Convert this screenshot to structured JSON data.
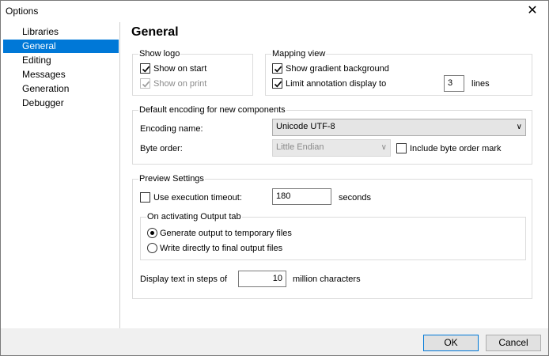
{
  "window": {
    "title": "Options",
    "close": "✕"
  },
  "sidebar": {
    "items": [
      {
        "label": "Libraries",
        "selected": false
      },
      {
        "label": "General",
        "selected": true
      },
      {
        "label": "Editing",
        "selected": false
      },
      {
        "label": "Messages",
        "selected": false
      },
      {
        "label": "Generation",
        "selected": false
      },
      {
        "label": "Debugger",
        "selected": false
      }
    ]
  },
  "page": {
    "title": "General"
  },
  "show_logo": {
    "label": "Show logo",
    "show_on_start": {
      "label": "Show on start",
      "checked": true
    },
    "show_on_print": {
      "label": "Show on print",
      "checked": true,
      "disabled": true
    }
  },
  "mapping_view": {
    "label": "Mapping view",
    "gradient": {
      "label": "Show gradient background",
      "checked": true
    },
    "limit": {
      "label": "Limit annotation display to",
      "checked": true,
      "value": "3",
      "unit": "lines"
    }
  },
  "encoding": {
    "label": "Default encoding for new components",
    "name_label": "Encoding name:",
    "name_value": "Unicode UTF-8",
    "byte_order_label": "Byte order:",
    "byte_order_value": "Little Endian",
    "bom": {
      "label": "Include byte order mark",
      "checked": false
    }
  },
  "preview": {
    "label": "Preview Settings",
    "timeout": {
      "label": "Use execution timeout:",
      "checked": false,
      "value": "180",
      "unit": "seconds"
    },
    "output_tab": {
      "label": "On activating Output tab",
      "options": [
        {
          "label": "Generate output to temporary files",
          "selected": true
        },
        {
          "label": "Write directly to final output files",
          "selected": false
        }
      ]
    },
    "steps": {
      "label": "Display text in steps of",
      "value": "10",
      "unit": "million characters"
    }
  },
  "footer": {
    "ok": "OK",
    "cancel": "Cancel"
  }
}
